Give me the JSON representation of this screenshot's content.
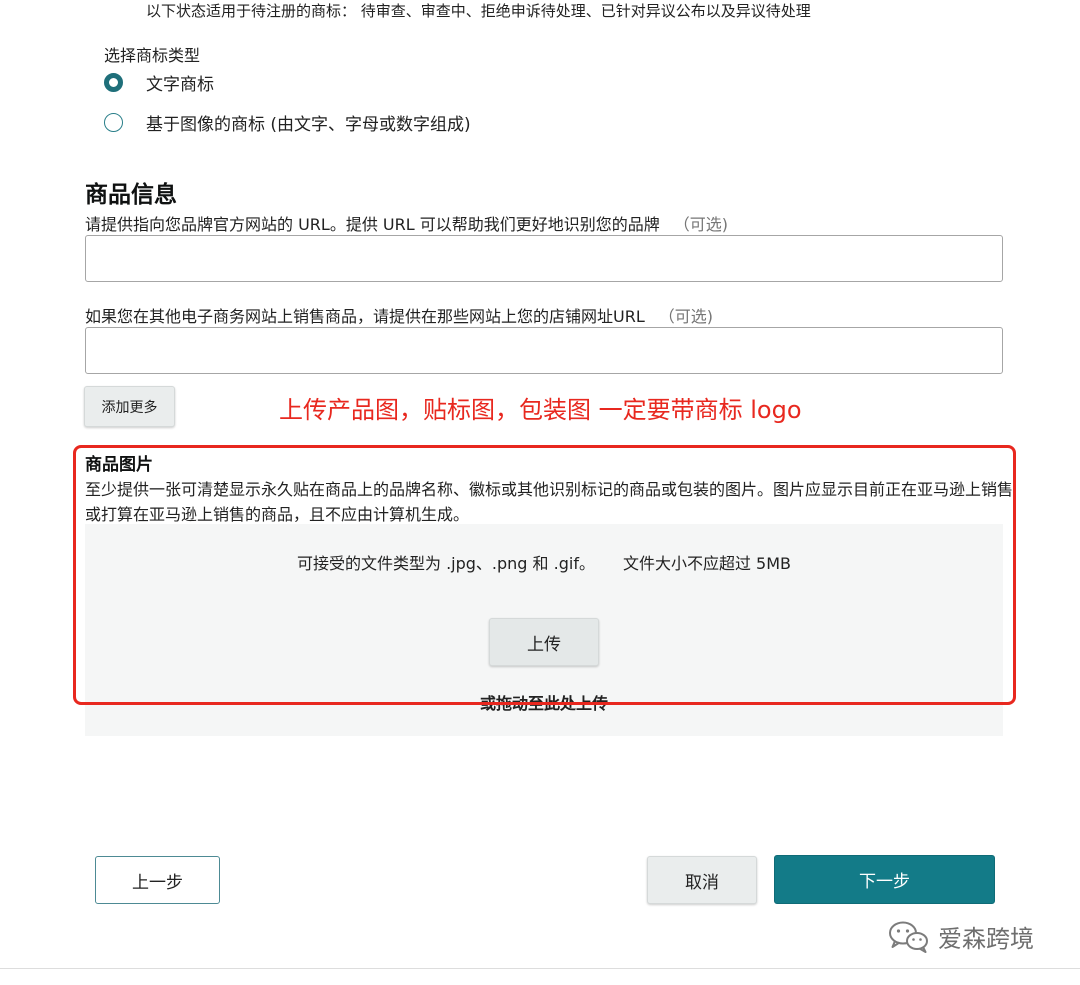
{
  "top_note": "以下状态适用于待注册的商标： 待审查、审查中、拒绝申诉待处理、已针对异议公布以及异议待处理",
  "trademark_type": {
    "label": "选择商标类型",
    "options": [
      {
        "label": "文字商标",
        "selected": true
      },
      {
        "label": "基于图像的商标 (由文字、字母或数字组成)",
        "selected": false
      }
    ]
  },
  "product_info": {
    "title": "商品信息",
    "brand_url": {
      "label": "请提供指向您品牌官方网站的 URL。提供 URL 可以帮助我们更好地识别您的品牌",
      "optional": "（可选)",
      "value": "",
      "placeholder": ""
    },
    "store_url": {
      "label": "如果您在其他电子商务网站上销售商品，请提供在那些网站上您的店铺网址URL",
      "optional": "（可选)",
      "value": "",
      "placeholder": ""
    },
    "add_more": "添加更多"
  },
  "annotation": "上传产品图，贴标图，包装图 一定要带商标 logo",
  "product_images": {
    "title": "商品图片",
    "description": "至少提供一张可清楚显示永久贴在商品上的品牌名称、徽标或其他识别标记的商品或包装的图片。图片应显示目前正在亚马逊上销售或打算在亚马逊上销售的商品，且不应由计算机生成。",
    "file_types": "可接受的文件类型为 .jpg、.png 和 .gif。",
    "size_limit": "文件大小不应超过 5MB",
    "upload_button": "上传",
    "drag_text": "或拖动至此处上传"
  },
  "footer": {
    "back": "上一步",
    "cancel": "取消",
    "next": "下一步"
  },
  "watermark": "爱森跨境",
  "colors": {
    "accent": "#137b88",
    "annotation_red": "#e8281f"
  }
}
